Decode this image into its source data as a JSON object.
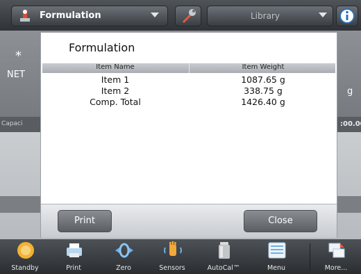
{
  "topbar": {
    "app_label": "Formulation",
    "library_label": "Library"
  },
  "background": {
    "star": "*",
    "net": "NET",
    "unit": "g",
    "capacity_fragment": "Capaci",
    "capacity_value_fragment": ":00.00"
  },
  "dialog": {
    "title": "Formulation",
    "columns": [
      "Item Name",
      "Item Weight"
    ],
    "rows": [
      {
        "name": "Item 1",
        "weight": "1087.65 g"
      },
      {
        "name": "Item 2",
        "weight": "338.75 g"
      },
      {
        "name": "Comp. Total",
        "weight": "1426.40 g"
      }
    ],
    "print_label": "Print",
    "close_label": "Close"
  },
  "toolbar": {
    "items": [
      {
        "label": "Standby",
        "icon": "standby-icon"
      },
      {
        "label": "Print",
        "icon": "printer-icon"
      },
      {
        "label": "Zero",
        "icon": "zero-icon"
      },
      {
        "label": "Sensors",
        "icon": "hand-sensor-icon"
      },
      {
        "label": "AutoCal™",
        "icon": "calibration-weight-icon"
      },
      {
        "label": "Menu",
        "icon": "menu-icon"
      },
      {
        "label": "More...",
        "icon": "more-icon"
      }
    ]
  },
  "colors": {
    "dialog_bg": "#ffffff",
    "header_bg": "#b9bcc0",
    "button_bg": "#6f7378",
    "toolbar_bg": "#3a3e42"
  }
}
